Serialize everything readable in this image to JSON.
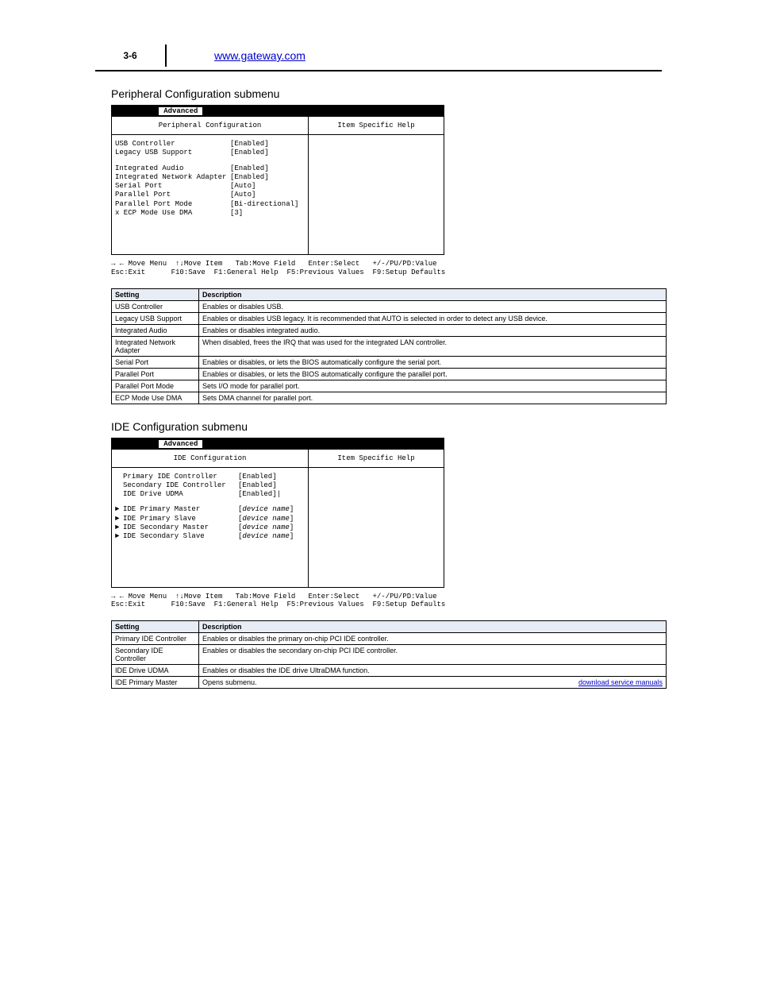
{
  "header": {
    "page_num": "3-6",
    "link_text": "www.gateway.com"
  },
  "section1": {
    "title": "Peripheral Configuration submenu",
    "tab": "Advanced",
    "subheader_left": "Peripheral Configuration",
    "subheader_right": "Item Specific Help",
    "rows_block1": [
      {
        "label": "USB Controller",
        "value": "[Enabled]"
      },
      {
        "label": "Legacy USB Support",
        "value": "[Enabled]"
      }
    ],
    "rows_block2": [
      {
        "label": "Integrated Audio",
        "value": "[Enabled]"
      },
      {
        "label": "Integrated Network Adapter",
        "value": "[Enabled]"
      },
      {
        "label": "Serial Port",
        "value": "[Auto]"
      },
      {
        "label": "Parallel Port",
        "value": "[Auto]"
      },
      {
        "label": "Parallel Port Mode",
        "value": "[Bi-directional]"
      },
      {
        "label": "x ECP Mode Use DMA",
        "value": "[3]"
      }
    ],
    "table_header": [
      "Setting",
      "Description"
    ],
    "table_rows": [
      [
        "USB Controller",
        "Enables or disables USB."
      ],
      [
        "Legacy USB Support",
        "Enables or disables USB legacy. It is recommended that AUTO is selected in order to detect any USB device."
      ],
      [
        "Integrated Audio",
        "Enables or disables integrated audio."
      ],
      [
        "Integrated Network Adapter",
        "When disabled, frees the IRQ that was used for the integrated LAN controller."
      ],
      [
        "Serial Port",
        "Enables or disables, or lets the BIOS automatically configure the serial port."
      ],
      [
        "Parallel Port",
        "Enables or disables, or lets the BIOS automatically configure the parallel port."
      ],
      [
        "Parallel Port Mode",
        "Sets I/O mode for parallel port."
      ],
      [
        "ECP Mode Use DMA",
        "Sets DMA channel for parallel port."
      ]
    ]
  },
  "section2": {
    "title": "IDE Configuration submenu",
    "subheader_left": "IDE Configuration",
    "subheader_right": "Item Specific Help",
    "rows_block1": [
      {
        "label": "Primary IDE Controller",
        "value": "[Enabled]"
      },
      {
        "label": "Secondary IDE Controller",
        "value": "[Enabled]"
      },
      {
        "label": "IDE Drive UDMA",
        "value": "[Enabled]|"
      }
    ],
    "rows_block2": [
      {
        "arrow": "►",
        "label": "IDE Primary Master",
        "value_prefix": "[",
        "value_italic": "device name",
        "value_suffix": "]"
      },
      {
        "arrow": "►",
        "label": "IDE Primary Slave",
        "value_prefix": "[",
        "value_italic": "device name",
        "value_suffix": "]"
      },
      {
        "arrow": "►",
        "label": "IDE Secondary Master",
        "value_prefix": "[",
        "value_italic": "device name",
        "value_suffix": "]"
      },
      {
        "arrow": "►",
        "label": "IDE Secondary Slave",
        "value_prefix": "[",
        "value_italic": "device name",
        "value_suffix": "]"
      }
    ],
    "table_header": [
      "Setting",
      "Description"
    ],
    "table_rows": [
      [
        "Primary IDE Controller",
        "Enables or disables the primary on-chip PCI IDE controller."
      ],
      [
        "Secondary IDE Controller",
        "Enables or disables the secondary on-chip PCI IDE controller."
      ],
      [
        "IDE Drive UDMA",
        "Enables or disables the IDE drive UltraDMA function."
      ],
      [
        "IDE Primary Master",
        "Opens submenu."
      ]
    ],
    "footer_link_text": "download service manuals"
  },
  "navhelp": {
    "row1a": "→ ← Move Menu",
    "row1b": "↑↓Move Item",
    "row1c": "Tab:Move Field",
    "row1d": "Enter:Select",
    "row1e": "+/-/PU/PD:Value",
    "row2a": "Esc:Exit",
    "row2b": "F10:Save",
    "row2c": "F1:General Help",
    "row2d": "F5:Previous Values",
    "row2e": "F9:Setup Defaults"
  }
}
